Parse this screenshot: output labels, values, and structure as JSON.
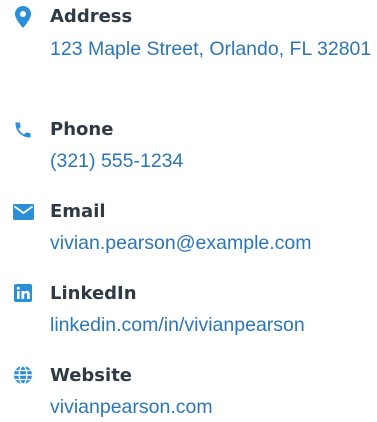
{
  "contact": {
    "address": {
      "label": "Address",
      "value": "123 Maple Street, Orlando, FL 32801",
      "icon": "map-pin-icon"
    },
    "phone": {
      "label": "Phone",
      "value": "(321) 555-1234",
      "icon": "phone-icon"
    },
    "email": {
      "label": "Email",
      "value": "vivian.pearson@example.com",
      "icon": "envelope-icon"
    },
    "linkedin": {
      "label": "LinkedIn",
      "value": "linkedin.com/in/vivianpearson",
      "icon": "linkedin-icon"
    },
    "website": {
      "label": "Website",
      "value": "vivianpearson.com",
      "icon": "globe-icon"
    }
  },
  "colors": {
    "icon": "#2b8fd8",
    "label": "#2f3a44",
    "value": "#2b76b8"
  }
}
